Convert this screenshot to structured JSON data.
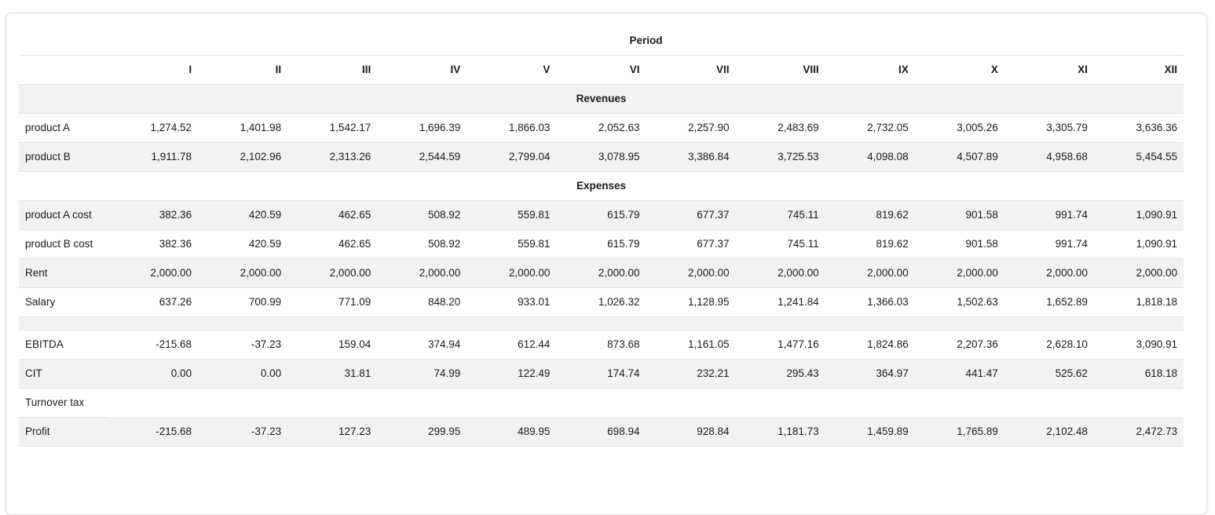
{
  "table": {
    "group_header": "Period",
    "columns": [
      "I",
      "II",
      "III",
      "IV",
      "V",
      "VI",
      "VII",
      "VIII",
      "IX",
      "X",
      "XI",
      "XII"
    ],
    "sections": {
      "revenues": "Revenues",
      "expenses": "Expenses"
    },
    "rows": {
      "product_a": {
        "label": "product A",
        "values": [
          "1,274.52",
          "1,401.98",
          "1,542.17",
          "1,696.39",
          "1,866.03",
          "2,052.63",
          "2,257.90",
          "2,483.69",
          "2,732.05",
          "3,005.26",
          "3,305.79",
          "3,636.36"
        ]
      },
      "product_b": {
        "label": "product B",
        "values": [
          "1,911.78",
          "2,102.96",
          "2,313.26",
          "2,544.59",
          "2,799.04",
          "3,078.95",
          "3,386.84",
          "3,725.53",
          "4,098.08",
          "4,507.89",
          "4,958.68",
          "5,454.55"
        ]
      },
      "product_a_cost": {
        "label": "product A cost",
        "values": [
          "382.36",
          "420.59",
          "462.65",
          "508.92",
          "559.81",
          "615.79",
          "677.37",
          "745.11",
          "819.62",
          "901.58",
          "991.74",
          "1,090.91"
        ]
      },
      "product_b_cost": {
        "label": "product B cost",
        "values": [
          "382.36",
          "420.59",
          "462.65",
          "508.92",
          "559.81",
          "615.79",
          "677.37",
          "745.11",
          "819.62",
          "901.58",
          "991.74",
          "1,090.91"
        ]
      },
      "rent": {
        "label": "Rent",
        "values": [
          "2,000.00",
          "2,000.00",
          "2,000.00",
          "2,000.00",
          "2,000.00",
          "2,000.00",
          "2,000.00",
          "2,000.00",
          "2,000.00",
          "2,000.00",
          "2,000.00",
          "2,000.00"
        ]
      },
      "salary": {
        "label": "Salary",
        "values": [
          "637.26",
          "700.99",
          "771.09",
          "848.20",
          "933.01",
          "1,026.32",
          "1,128.95",
          "1,241.84",
          "1,366.03",
          "1,502.63",
          "1,652.89",
          "1,818.18"
        ]
      },
      "ebitda": {
        "label": "EBITDA",
        "values": [
          "-215.68",
          "-37.23",
          "159.04",
          "374.94",
          "612.44",
          "873.68",
          "1,161.05",
          "1,477.16",
          "1,824.86",
          "2,207.36",
          "2,628.10",
          "3,090.91"
        ]
      },
      "cit": {
        "label": "CIT",
        "values": [
          "0.00",
          "0.00",
          "31.81",
          "74.99",
          "122.49",
          "174.74",
          "232.21",
          "295.43",
          "364.97",
          "441.47",
          "525.62",
          "618.18"
        ]
      },
      "turnover_tax": {
        "label": "Turnover tax",
        "values": []
      },
      "profit": {
        "label": "Profit",
        "values": [
          "-215.68",
          "-37.23",
          "127.23",
          "299.95",
          "489.95",
          "698.94",
          "928.84",
          "1,181.73",
          "1,459.89",
          "1,765.89",
          "2,102.48",
          "2,472.73"
        ]
      }
    }
  },
  "colors": {
    "row_shade": "#f2f2f2",
    "border": "#e3e3e3",
    "text": "#1a1a1a"
  }
}
